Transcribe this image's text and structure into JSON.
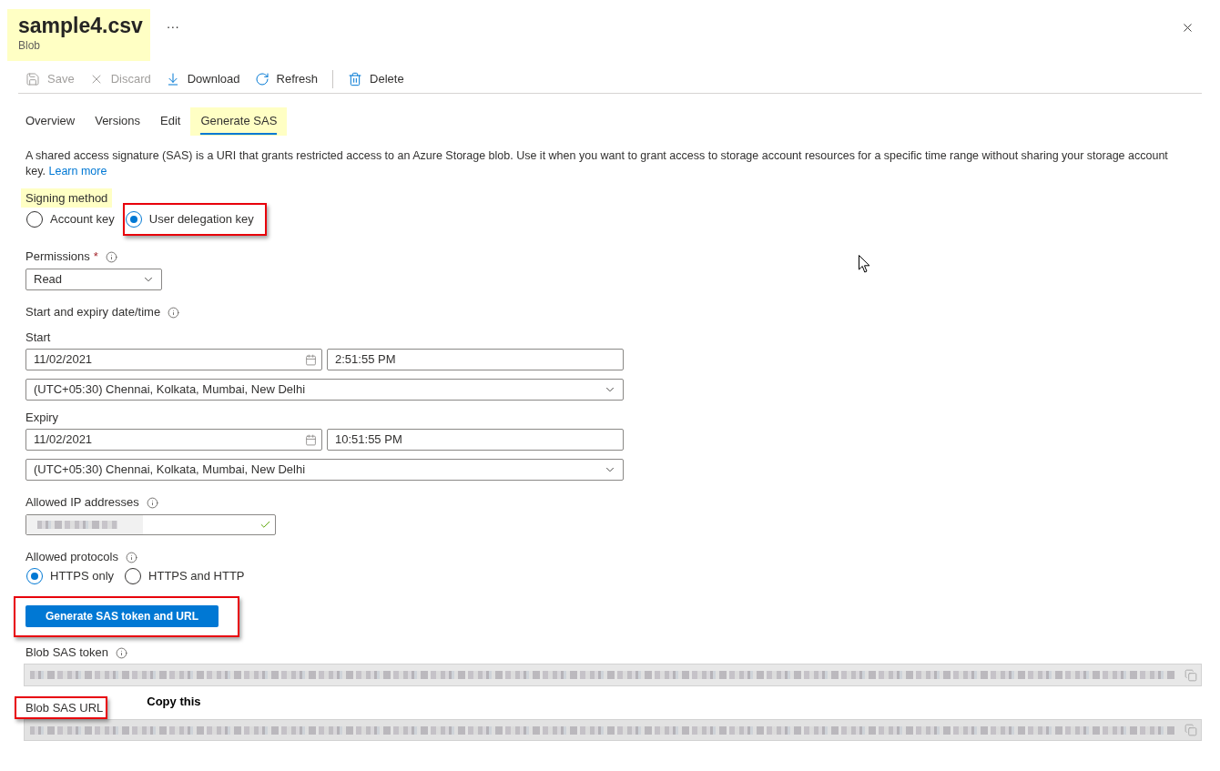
{
  "header": {
    "title": "sample4.csv",
    "subtitle": "Blob",
    "more": "···",
    "highlighted": true
  },
  "toolbar": [
    {
      "kind": "save",
      "label": "Save",
      "disabled": true
    },
    {
      "kind": "discard",
      "label": "Discard",
      "disabled": true
    },
    {
      "kind": "download",
      "label": "Download",
      "disabled": false
    },
    {
      "kind": "refresh",
      "label": "Refresh",
      "disabled": false
    },
    {
      "kind": "separator"
    },
    {
      "kind": "delete",
      "label": "Delete",
      "disabled": false
    }
  ],
  "tabs": [
    {
      "label": "Overview",
      "selected": false,
      "highlighted": false
    },
    {
      "label": "Versions",
      "selected": false,
      "highlighted": false
    },
    {
      "label": "Edit",
      "selected": false,
      "highlighted": false
    },
    {
      "label": "Generate SAS",
      "selected": true,
      "highlighted": true
    }
  ],
  "description": {
    "text": "A shared access signature (SAS) is a URI that grants restricted access to an Azure Storage blob. Use it when you want to grant access to storage account resources for a specific time range without sharing your storage account key.",
    "link": "Learn more"
  },
  "signing_method": {
    "label": "Signing method",
    "highlighted": true,
    "options": [
      {
        "label": "Account key",
        "selected": false,
        "annotated": false
      },
      {
        "label": "User delegation key",
        "selected": true,
        "annotated": true
      }
    ]
  },
  "permissions": {
    "label": "Permissions",
    "required_mark": "*",
    "info": true,
    "value": "Read"
  },
  "date_time": {
    "label": "Start and expiry date/time",
    "info": true,
    "ranges": [
      {
        "label": "Start",
        "date": "11/02/2021",
        "time": "2:51:55 PM",
        "timezone": "(UTC+05:30) Chennai, Kolkata, Mumbai, New Delhi"
      },
      {
        "label": "Expiry",
        "date": "11/02/2021",
        "time": "10:51:55 PM",
        "timezone": "(UTC+05:30) Chennai, Kolkata, Mumbai, New Delhi"
      }
    ]
  },
  "allowed_ip": {
    "label": "Allowed IP addresses",
    "info": true,
    "redacted": true,
    "valid": true
  },
  "allowed_protocols": {
    "label": "Allowed protocols",
    "info": true,
    "options": [
      {
        "label": "HTTPS only",
        "selected": true
      },
      {
        "label": "HTTPS and HTTP",
        "selected": false
      }
    ]
  },
  "generate_button": {
    "label": "Generate SAS token and URL",
    "annotated": true
  },
  "sas_token": {
    "label": "Blob SAS token",
    "info": true,
    "annotated": false,
    "redacted": true
  },
  "sas_url": {
    "label": "Blob SAS URL",
    "info": false,
    "annotated": true,
    "redacted": true,
    "note": "Copy this"
  }
}
